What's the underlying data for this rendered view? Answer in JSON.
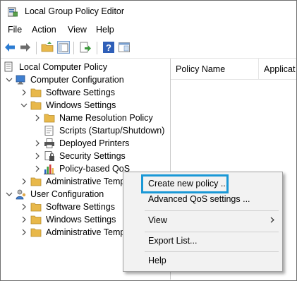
{
  "window": {
    "title": "Local Group Policy Editor"
  },
  "menu": [
    "File",
    "Action",
    "View",
    "Help"
  ],
  "toolbar": {
    "icons": [
      "back-arrow-icon",
      "forward-arrow-icon",
      "up-folder-icon",
      "show-hide-tree-icon",
      "export-list-icon",
      "help-icon",
      "properties-pane-icon"
    ]
  },
  "tree": {
    "root": "Local Computer Policy",
    "computer_config": "Computer Configuration",
    "cc_software": "Software Settings",
    "cc_windows": "Windows Settings",
    "name_resolution": "Name Resolution Policy",
    "scripts": "Scripts (Startup/Shutdown)",
    "printers": "Deployed Printers",
    "security": "Security Settings",
    "qos": "Policy-based QoS",
    "cc_admin": "Administrative Temp",
    "user_config": "User Configuration",
    "uc_software": "Software Settings",
    "uc_windows": "Windows Settings",
    "uc_admin": "Administrative Temp"
  },
  "list": {
    "col_policy_name": "Policy Name",
    "col_application": "Applicat"
  },
  "context_menu": {
    "create": "Create new policy ...",
    "advanced": "Advanced QoS settings ...",
    "view": "View",
    "export": "Export List...",
    "help": "Help"
  },
  "colors": {
    "highlight_border": "#1a98d6",
    "folder": "#e8b84a",
    "menu_bg": "#f2f2f2"
  }
}
